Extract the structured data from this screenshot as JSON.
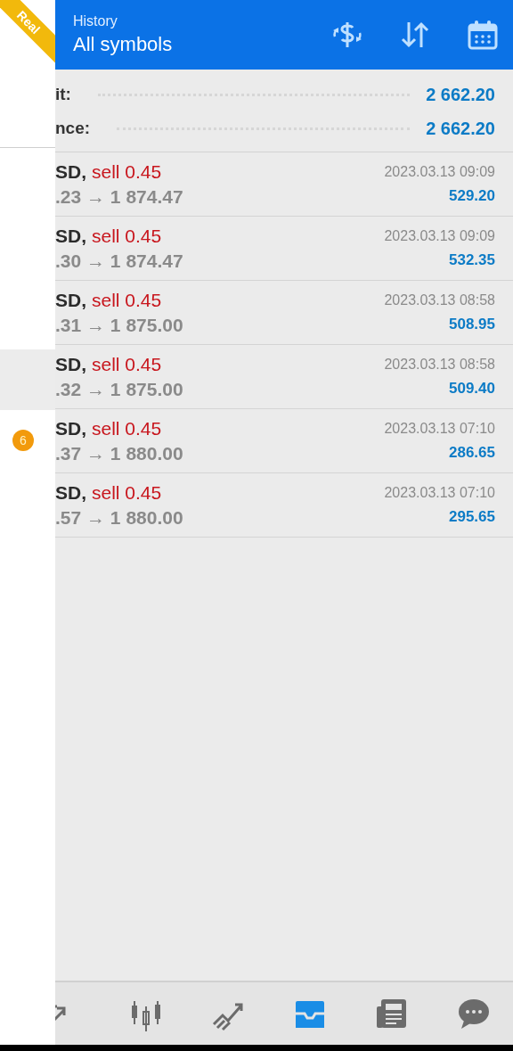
{
  "header": {
    "subtitle": "History",
    "title": "All symbols",
    "actions": [
      {
        "kind": "currency"
      },
      {
        "kind": "sort"
      },
      {
        "kind": "calendar"
      }
    ]
  },
  "summary": [
    {
      "label": "it:",
      "value": "2 662.20"
    },
    {
      "label": "nce:",
      "value": "2 662.20"
    }
  ],
  "trades": [
    {
      "symbol": "SD,",
      "type": "sell 0.45",
      "prices": ".23 → 1 874.47",
      "time": "2023.03.13 09:09",
      "profit": "529.20"
    },
    {
      "symbol": "SD,",
      "type": "sell 0.45",
      "prices": ".30 → 1 874.47",
      "time": "2023.03.13 09:09",
      "profit": "532.35"
    },
    {
      "symbol": "SD,",
      "type": "sell 0.45",
      "prices": ".31 → 1 875.00",
      "time": "2023.03.13 08:58",
      "profit": "508.95"
    },
    {
      "symbol": "SD,",
      "type": "sell 0.45",
      "prices": ".32 → 1 875.00",
      "time": "2023.03.13 08:58",
      "profit": "509.40"
    },
    {
      "symbol": "SD,",
      "type": "sell 0.45",
      "prices": ".37 → 1 880.00",
      "time": "2023.03.13 07:10",
      "profit": "286.65"
    },
    {
      "symbol": "SD,",
      "type": "sell 0.45",
      "prices": ".57 → 1 880.00",
      "time": "2023.03.13 07:10",
      "profit": "295.65"
    }
  ],
  "nav": [
    {
      "kind": "arrow",
      "selected": false
    },
    {
      "kind": "candles",
      "selected": false
    },
    {
      "kind": "trend",
      "selected": false
    },
    {
      "kind": "inbox",
      "selected": true
    },
    {
      "kind": "news",
      "selected": false
    },
    {
      "kind": "chat",
      "selected": false
    }
  ],
  "drawer": {
    "ribbon": "Real",
    "badge": "6"
  }
}
